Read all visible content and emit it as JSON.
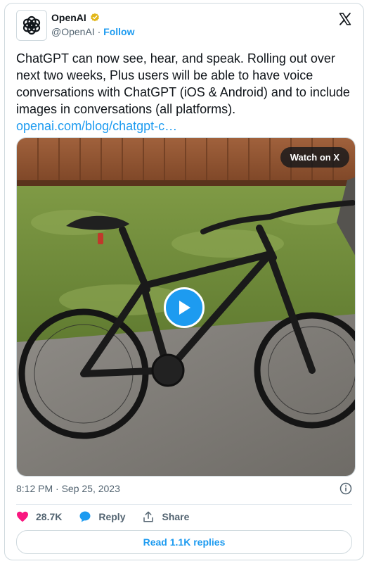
{
  "author": {
    "name": "OpenAI",
    "handle": "@OpenAI",
    "separator": "·",
    "follow_label": "Follow"
  },
  "tweet": {
    "text": "ChatGPT can now see, hear, and speak. Rolling out over next two weeks, Plus users will be able to have voice conversations with ChatGPT (iOS & Android) and to include images in conversations (all platforms).",
    "link": "openai.com/blog/chatgpt-c…",
    "timestamp": "8:12 PM · Sep 25, 2023"
  },
  "media": {
    "watch_label": "Watch on X"
  },
  "actions": {
    "likes": "28.7K",
    "reply_label": "Reply",
    "share_label": "Share",
    "read_replies_label": "Read 1.1K replies"
  },
  "colors": {
    "accent": "#1d9bf0",
    "like": "#f91880",
    "muted": "#536471"
  }
}
